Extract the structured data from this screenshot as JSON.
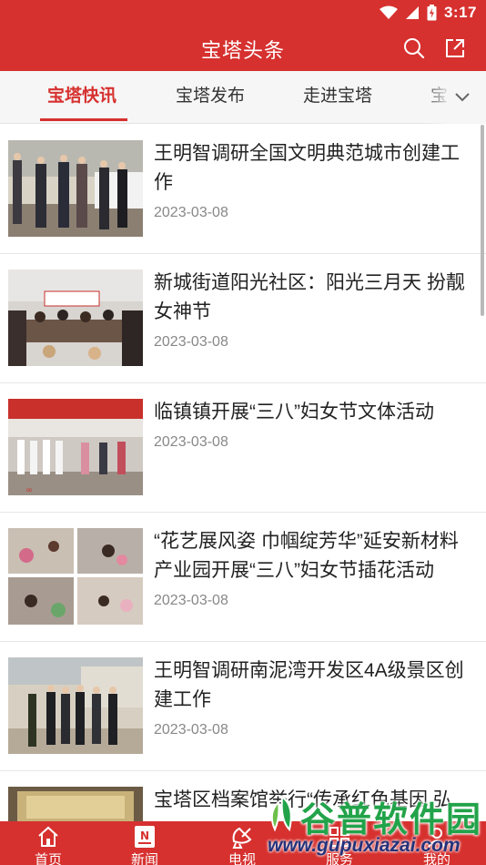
{
  "status_bar": {
    "time": "3:17"
  },
  "header": {
    "title": "宝塔头条",
    "search_icon": "search-icon",
    "share_icon": "share-icon"
  },
  "tabs": [
    {
      "label": "宝塔快讯",
      "active": true
    },
    {
      "label": "宝塔发布",
      "active": false
    },
    {
      "label": "走进宝塔",
      "active": false
    },
    {
      "label": "宝",
      "active": false
    }
  ],
  "news": [
    {
      "title": "王明智调研全国文明典范城市创建工作",
      "date": "2023-03-08"
    },
    {
      "title": "新城街道阳光社区：阳光三月天 扮靓女神节",
      "date": "2023-03-08"
    },
    {
      "title": "临镇镇开展“三八”妇女节文体活动",
      "date": "2023-03-08"
    },
    {
      "title": "“花艺展风姿 巾帼绽芳华”延安新材料产业园开展“三八”妇女节插花活动",
      "date": "2023-03-08"
    },
    {
      "title": "王明智调研南泥湾开发区4A级景区创建工作",
      "date": "2023-03-08"
    },
    {
      "title": "宝塔区档案馆举行“传承红色基因 弘",
      "date": ""
    }
  ],
  "bottom_nav": [
    {
      "label": "首页",
      "icon": "home-icon"
    },
    {
      "label": "新闻",
      "icon": "news-icon"
    },
    {
      "label": "电视",
      "icon": "tv-icon"
    },
    {
      "label": "服务",
      "icon": "service-icon"
    },
    {
      "label": "我的",
      "icon": "user-icon"
    }
  ],
  "watermark": {
    "text": "谷普软件园",
    "url": "www.gupuxiazai.com"
  },
  "colors": {
    "primary": "#d6312f",
    "tab_bar": "#f6f6f6",
    "date_text": "#888888"
  }
}
